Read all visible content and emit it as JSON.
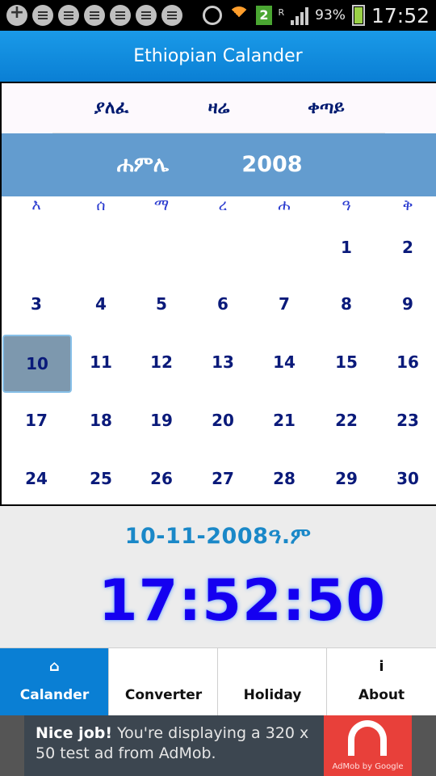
{
  "status_bar": {
    "battery": "93%",
    "sim": "2",
    "network_mark": "R",
    "time": "17:52"
  },
  "app_bar": {
    "title": "Ethiopian Calander"
  },
  "calendar": {
    "nav": {
      "prev": "ያለፈ",
      "today": "ዛሬ",
      "next": "ቀጣይ"
    },
    "month": "ሐምሌ",
    "year": "2008",
    "weekdays": [
      "እ",
      "ሰ",
      "ማ",
      "ረ",
      "ሐ",
      "ዓ",
      "ቅ"
    ],
    "weeks": [
      [
        "",
        "",
        "",
        "",
        "",
        "1",
        "2"
      ],
      [
        "3",
        "4",
        "5",
        "6",
        "7",
        "8",
        "9"
      ],
      [
        "10",
        "11",
        "12",
        "13",
        "14",
        "15",
        "16"
      ],
      [
        "17",
        "18",
        "19",
        "20",
        "21",
        "22",
        "23"
      ],
      [
        "24",
        "25",
        "26",
        "27",
        "28",
        "29",
        "30"
      ]
    ],
    "selected_day": "10"
  },
  "info": {
    "gregorian_date": "10-11-2008ዓ.ም",
    "clock": "17:52:50"
  },
  "tabs": [
    {
      "label": "Calander",
      "icon": "home-icon",
      "glyph": "⌂",
      "active": true
    },
    {
      "label": "Converter",
      "icon": "",
      "glyph": "",
      "active": false
    },
    {
      "label": "Holiday",
      "icon": "",
      "glyph": "",
      "active": false
    },
    {
      "label": "About",
      "icon": "info-icon",
      "glyph": "i",
      "active": false
    }
  ],
  "ad": {
    "headline": "Nice job!",
    "body": "You're displaying a 320 x 50 test ad from AdMob.",
    "brand": "AdMob by Google"
  },
  "colors": {
    "app_bar": "#0a7fd4",
    "month_bar": "#639ccf",
    "day_text": "#0a1a7a",
    "clock": "#1500f0",
    "date_text": "#1a88c8"
  }
}
